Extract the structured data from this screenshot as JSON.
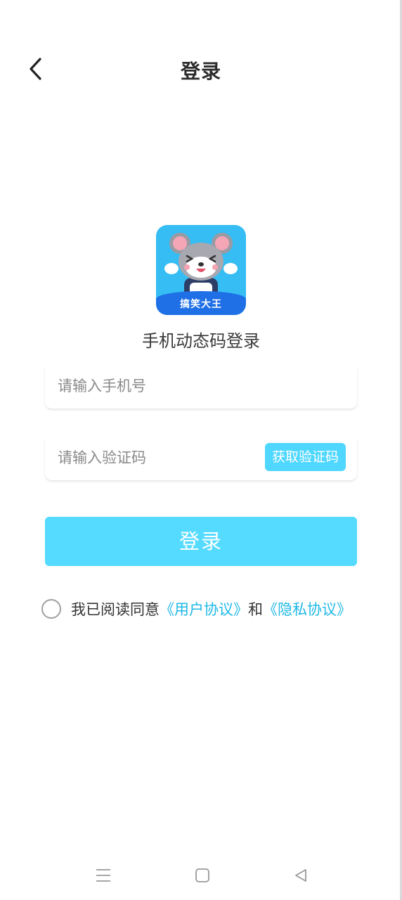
{
  "header": {
    "title": "登录",
    "back_icon": "chevron-left-icon"
  },
  "logo": {
    "text": "搞笑大王",
    "bg_color": "#35bdf4",
    "banner_color": "#1f6fe6",
    "character": "mouse-mascot"
  },
  "subtitle": "手机动态码登录",
  "phone": {
    "placeholder": "请输入手机号",
    "value": ""
  },
  "code": {
    "placeholder": "请输入验证码",
    "value": "",
    "get_code_label": "获取验证码"
  },
  "login_button": {
    "label": "登录",
    "color": "#55dbff"
  },
  "agreement": {
    "checked": false,
    "prefix": "我已阅读同意",
    "user_link": "《用户协议》",
    "joiner": "和",
    "privacy_link": "《隐私协议》",
    "link_color": "#1fb8e6"
  },
  "navbar": {
    "menu_icon": "menu-icon",
    "home_icon": "home-square-icon",
    "back_icon": "back-triangle-icon"
  }
}
